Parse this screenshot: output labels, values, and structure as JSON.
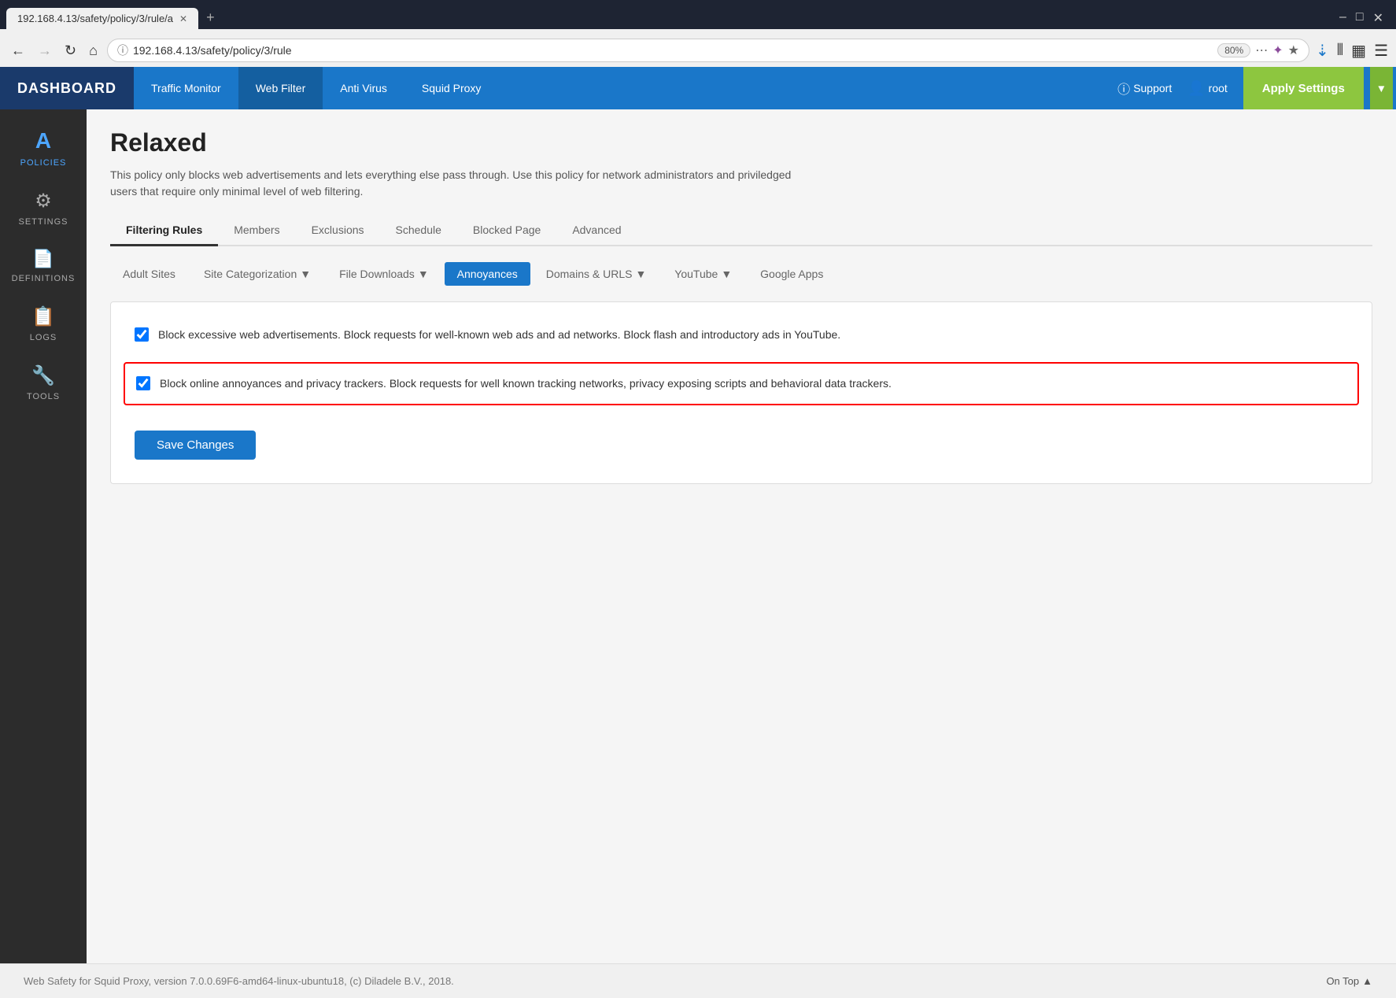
{
  "browser": {
    "tab_title": "192.168.4.13/safety/policy/3/rule/a",
    "url": "192.168.4.13/safety/policy/3/rule",
    "zoom": "80%",
    "new_tab_icon": "+",
    "close_icon": "✕"
  },
  "header": {
    "brand": "DASHBOARD",
    "nav": [
      {
        "label": "Traffic Monitor",
        "active": false
      },
      {
        "label": "Web Filter",
        "active": true
      },
      {
        "label": "Anti Virus",
        "active": false
      },
      {
        "label": "Squid Proxy",
        "active": false
      }
    ],
    "support_label": "Support",
    "user_label": "root",
    "apply_label": "Apply Settings"
  },
  "sidebar": [
    {
      "label": "POLICIES",
      "icon": "A",
      "active": true
    },
    {
      "label": "SETTINGS",
      "icon": "⚙",
      "active": false
    },
    {
      "label": "DEFINITIONS",
      "icon": "≡",
      "active": false
    },
    {
      "label": "LOGS",
      "icon": "📋",
      "active": false
    },
    {
      "label": "TOOLS",
      "icon": "🔧",
      "active": false
    }
  ],
  "page": {
    "title": "Relaxed",
    "description": "This policy only blocks web advertisements and lets everything else pass through. Use this policy for network administrators and priviledged users that require only minimal level of web filtering."
  },
  "tabs": [
    {
      "label": "Filtering Rules",
      "active": true
    },
    {
      "label": "Members",
      "active": false
    },
    {
      "label": "Exclusions",
      "active": false
    },
    {
      "label": "Schedule",
      "active": false
    },
    {
      "label": "Blocked Page",
      "active": false
    },
    {
      "label": "Advanced",
      "active": false
    }
  ],
  "sub_tabs": [
    {
      "label": "Adult Sites",
      "active": false,
      "dropdown": false
    },
    {
      "label": "Site Categorization",
      "active": false,
      "dropdown": true
    },
    {
      "label": "File Downloads",
      "active": false,
      "dropdown": true
    },
    {
      "label": "Annoyances",
      "active": true,
      "dropdown": false
    },
    {
      "label": "Domains & URLS",
      "active": false,
      "dropdown": true
    },
    {
      "label": "YouTube",
      "active": false,
      "dropdown": true
    },
    {
      "label": "Google Apps",
      "active": false,
      "dropdown": false
    }
  ],
  "checkboxes": [
    {
      "id": "cb1",
      "checked": true,
      "label": "Block excessive web advertisements. Block requests for well-known web ads and ad networks. Block flash and introductory ads in YouTube.",
      "highlighted": false
    },
    {
      "id": "cb2",
      "checked": true,
      "label": "Block online annoyances and privacy trackers. Block requests for well known tracking networks, privacy exposing scripts and behavioral data trackers.",
      "highlighted": true
    }
  ],
  "save_button": "Save Changes",
  "footer": {
    "copyright": "Web Safety for Squid Proxy, version 7.0.0.69F6-amd64-linux-ubuntu18, (c) Diladele B.V., 2018.",
    "on_top": "On Top"
  }
}
